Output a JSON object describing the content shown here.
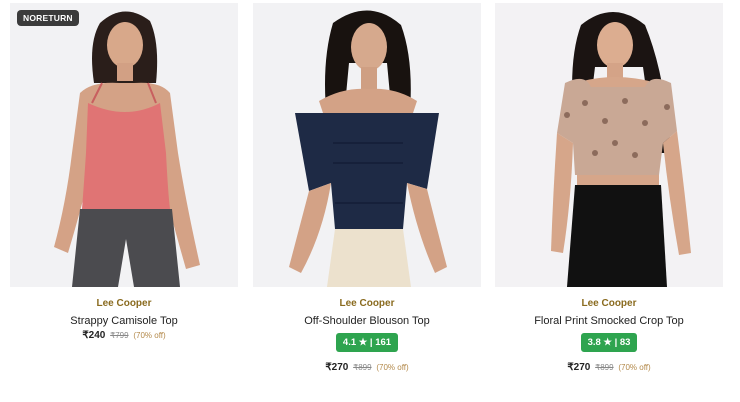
{
  "products": [
    {
      "badge": "NORETURN",
      "brand": "Lee Cooper",
      "name": "Strappy Camisole Top",
      "rating": "",
      "price": "₹240",
      "mrp": "₹799",
      "discount": "(70% off)"
    },
    {
      "badge": "",
      "brand": "Lee Cooper",
      "name": "Off-Shoulder Blouson Top",
      "rating": "4.1 ★ | 161",
      "price": "₹270",
      "mrp": "₹899",
      "discount": "(70% off)"
    },
    {
      "badge": "",
      "brand": "Lee Cooper",
      "name": "Floral Print Smocked Crop Top",
      "rating": "3.8 ★ | 83",
      "price": "₹270",
      "mrp": "₹899",
      "discount": "(70% off)"
    }
  ],
  "colors": {
    "rating_bg": "#2ea44f",
    "brand_text": "#8a6b1f",
    "badge_bg": "#3b3b3b",
    "top1": "#e07474",
    "top2": "#1e2a45",
    "top3": "#c9a895"
  }
}
